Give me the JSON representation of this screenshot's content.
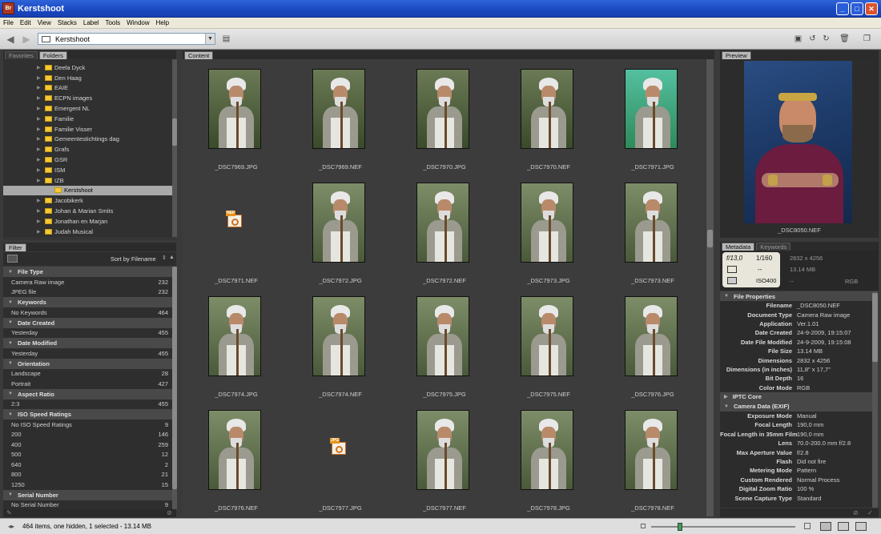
{
  "window": {
    "title": "Kerstshoot",
    "logo": "Br"
  },
  "menu": [
    "File",
    "Edit",
    "View",
    "Stacks",
    "Label",
    "Tools",
    "Window",
    "Help"
  ],
  "toolbar": {
    "path": "Kerstshoot"
  },
  "left_tabs": [
    "Favorites",
    "Folders"
  ],
  "folders": [
    {
      "label": "Deela Dyck",
      "level": 0
    },
    {
      "label": "Den Haag",
      "level": 0
    },
    {
      "label": "EAIE",
      "level": 0
    },
    {
      "label": "ECPN images",
      "level": 0
    },
    {
      "label": "Emergent NL",
      "level": 0
    },
    {
      "label": "Familie",
      "level": 0
    },
    {
      "label": "Familie Visser",
      "level": 0
    },
    {
      "label": "Gemeentestichtings dag",
      "level": 0
    },
    {
      "label": "Grafs",
      "level": 0
    },
    {
      "label": "GSR",
      "level": 0
    },
    {
      "label": "ISM",
      "level": 0
    },
    {
      "label": "IZB",
      "level": 0
    },
    {
      "label": "Kerstshoot",
      "level": 1,
      "selected": true
    },
    {
      "label": "Jacobikerk",
      "level": 0
    },
    {
      "label": "Johan & Marian Smits",
      "level": 0
    },
    {
      "label": "Jonathan en Marjan",
      "level": 0
    },
    {
      "label": "Judah Musical",
      "level": 0
    }
  ],
  "filter": {
    "tab": "Filter",
    "sort_label": "Sort by Filename",
    "sections": [
      {
        "title": "File Type",
        "items": [
          [
            "Camera Raw image",
            "232"
          ],
          [
            "JPEG file",
            "232"
          ]
        ]
      },
      {
        "title": "Keywords",
        "items": [
          [
            "No Keywords",
            "464"
          ]
        ]
      },
      {
        "title": "Date Created",
        "items": [
          [
            "Yesterday",
            "455"
          ]
        ]
      },
      {
        "title": "Date Modified",
        "items": [
          [
            "Yesterday",
            "455"
          ]
        ]
      },
      {
        "title": "Orientation",
        "items": [
          [
            "Landscape",
            "28"
          ],
          [
            "Portrait",
            "427"
          ]
        ]
      },
      {
        "title": "Aspect Ratio",
        "items": [
          [
            "2:3",
            "455"
          ]
        ]
      },
      {
        "title": "ISO Speed Ratings",
        "items": [
          [
            "No ISO Speed Ratings",
            "9"
          ],
          [
            "200",
            "146"
          ],
          [
            "400",
            "259"
          ],
          [
            "500",
            "12"
          ],
          [
            "640",
            "2"
          ],
          [
            "800",
            "21"
          ],
          [
            "1250",
            "15"
          ]
        ]
      },
      {
        "title": "Serial Number",
        "items": [
          [
            "No Serial Number",
            "9"
          ]
        ]
      }
    ]
  },
  "content": {
    "tab": "Content",
    "thumbs": [
      {
        "name": "_DSC7969.JPG",
        "kind": "photo",
        "tone": "b"
      },
      {
        "name": "_DSC7969.NEF",
        "kind": "photo",
        "tone": "b"
      },
      {
        "name": "_DSC7970.JPG",
        "kind": "photo",
        "tone": "b"
      },
      {
        "name": "_DSC7970.NEF",
        "kind": "photo",
        "tone": "b"
      },
      {
        "name": "_DSC7971.JPG",
        "kind": "photo",
        "tone": "g"
      },
      {
        "name": "_DSC7971.NEF",
        "kind": "raw",
        "badge": "NEF"
      },
      {
        "name": "_DSC7972.JPG",
        "kind": "photo",
        "tone": "c"
      },
      {
        "name": "_DSC7972.NEF",
        "kind": "photo",
        "tone": "c"
      },
      {
        "name": "_DSC7973.JPG",
        "kind": "photo",
        "tone": "c"
      },
      {
        "name": "_DSC7973.NEF",
        "kind": "photo",
        "tone": "c"
      },
      {
        "name": "_DSC7974.JPG",
        "kind": "photo",
        "tone": "c"
      },
      {
        "name": "_DSC7974.NEF",
        "kind": "photo",
        "tone": "c"
      },
      {
        "name": "_DSC7975.JPG",
        "kind": "photo",
        "tone": "c"
      },
      {
        "name": "_DSC7975.NEF",
        "kind": "photo",
        "tone": "c"
      },
      {
        "name": "_DSC7976.JPG",
        "kind": "photo",
        "tone": "c"
      },
      {
        "name": "_DSC7976.NEF",
        "kind": "photo",
        "tone": "c"
      },
      {
        "name": "_DSC7977.JPG",
        "kind": "raw",
        "badge": "JPG"
      },
      {
        "name": "_DSC7977.NEF",
        "kind": "photo",
        "tone": "c"
      },
      {
        "name": "_DSC7978.JPG",
        "kind": "photo",
        "tone": "c"
      },
      {
        "name": "_DSC7978.NEF",
        "kind": "photo",
        "tone": "c"
      }
    ]
  },
  "preview": {
    "tab": "Preview",
    "caption": "_DSC8050.NEF"
  },
  "metadata": {
    "tabs": [
      "Metadata",
      "Keywords"
    ],
    "summary": {
      "aperture": "f/13,0",
      "shutter": "1/160",
      "ev": "--",
      "iso": "ISO400",
      "dimensions": "2832 x 4256",
      "size": "13.14 MB",
      "dash": "--",
      "mode": "RGB"
    },
    "sections": [
      {
        "title": "File Properties",
        "open": true,
        "rows": [
          [
            "Filename",
            "_DSC8050.NEF"
          ],
          [
            "Document Type",
            "Camera Raw image"
          ],
          [
            "Application",
            "Ver.1.01"
          ],
          [
            "Date Created",
            "24-9-2009, 19:15:07"
          ],
          [
            "Date File Modified",
            "24-9-2009, 19:15:08"
          ],
          [
            "File Size",
            "13.14 MB"
          ],
          [
            "Dimensions",
            "2832 x 4256"
          ],
          [
            "Dimensions (in inches)",
            "11,8\" x 17,7\""
          ],
          [
            "Bit Depth",
            "16"
          ],
          [
            "Color Mode",
            "RGB"
          ]
        ]
      },
      {
        "title": "IPTC Core",
        "open": false,
        "rows": []
      },
      {
        "title": "Camera Data (EXIF)",
        "open": true,
        "rows": [
          [
            "Exposure Mode",
            "Manual"
          ],
          [
            "Focal Length",
            "190,0 mm"
          ],
          [
            "Focal Length in 35mm Film",
            "190,0 mm"
          ],
          [
            "Lens",
            "70.0-200.0 mm f/2.8"
          ],
          [
            "Max Aperture Value",
            "f/2.8"
          ],
          [
            "Flash",
            "Did not fire"
          ],
          [
            "Metering Mode",
            "Pattern"
          ],
          [
            "Custom Rendered",
            "Normal Process"
          ],
          [
            "Digital Zoom Ratio",
            "100 %"
          ],
          [
            "Scene Capture Type",
            "Standard"
          ]
        ]
      }
    ]
  },
  "status": {
    "text": "464 items, one hidden, 1 selected - 13.14 MB"
  }
}
